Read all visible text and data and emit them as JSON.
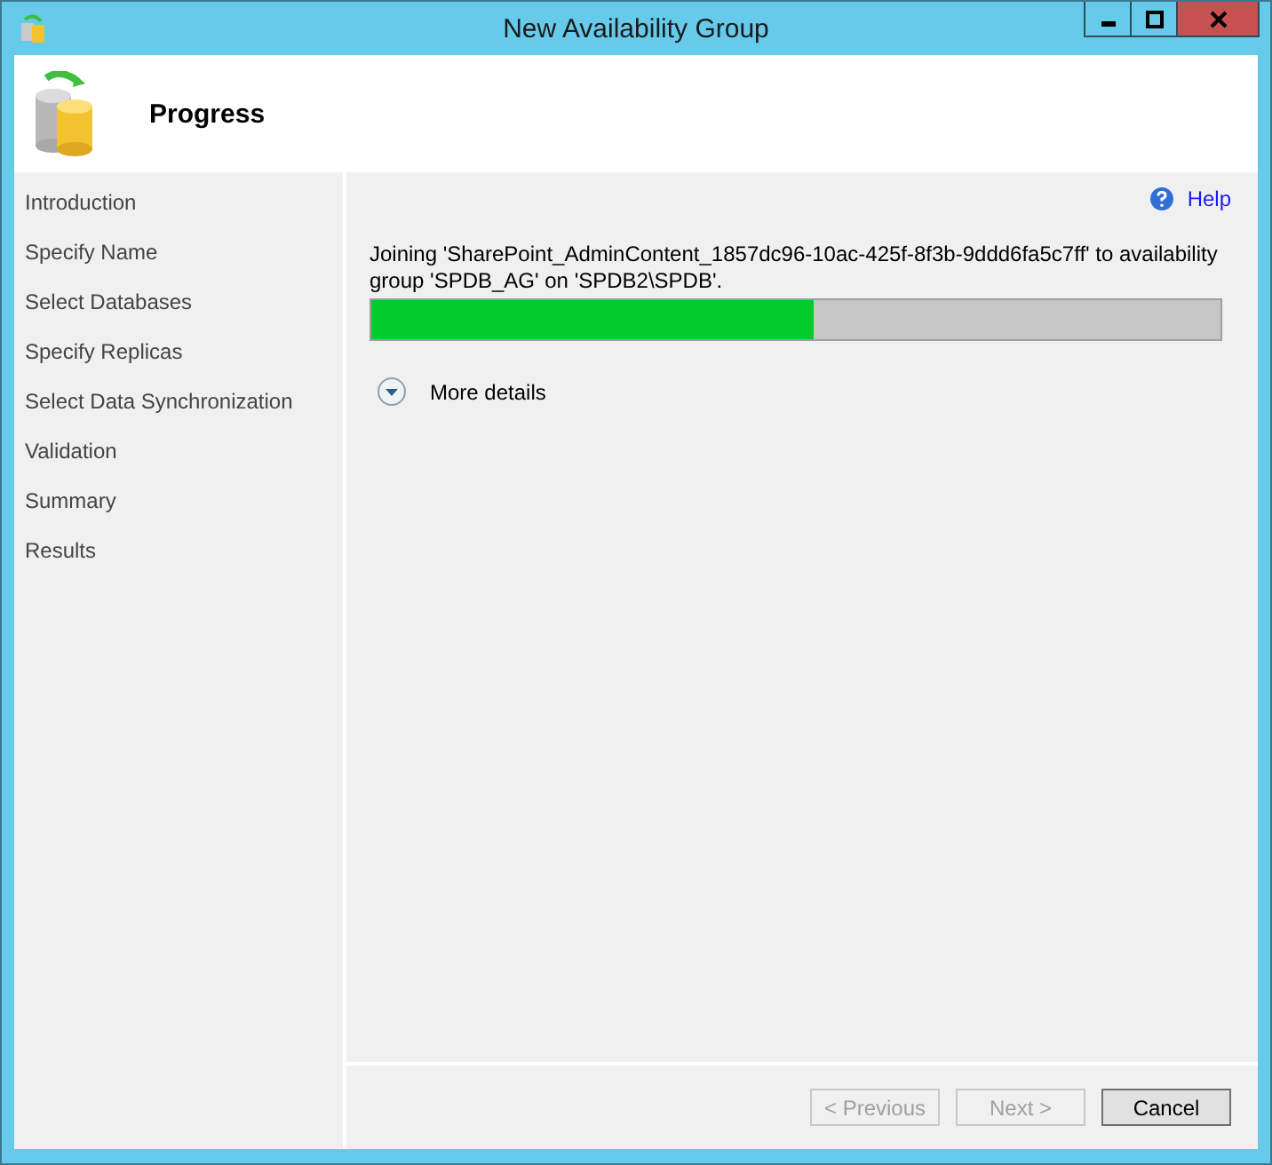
{
  "window": {
    "title": "New Availability Group"
  },
  "header": {
    "title": "Progress"
  },
  "sidebar": {
    "items": [
      {
        "label": "Introduction"
      },
      {
        "label": "Specify Name"
      },
      {
        "label": "Select Databases"
      },
      {
        "label": "Specify Replicas"
      },
      {
        "label": "Select Data Synchronization"
      },
      {
        "label": "Validation"
      },
      {
        "label": "Summary"
      },
      {
        "label": "Results"
      }
    ]
  },
  "help": {
    "label": "Help"
  },
  "progress": {
    "message": "Joining 'SharePoint_AdminContent_1857dc96-10ac-425f-8f3b-9ddd6fa5c7ff' to availability group 'SPDB_AG' on 'SPDB2\\SPDB'.",
    "level": 0.52
  },
  "details": {
    "label": "More details",
    "expanded": false
  },
  "buttons": [
    {
      "label": "< Previous",
      "disabled": true
    },
    {
      "label": "Next >",
      "disabled": true
    },
    {
      "label": "Cancel",
      "disabled": false
    }
  ]
}
